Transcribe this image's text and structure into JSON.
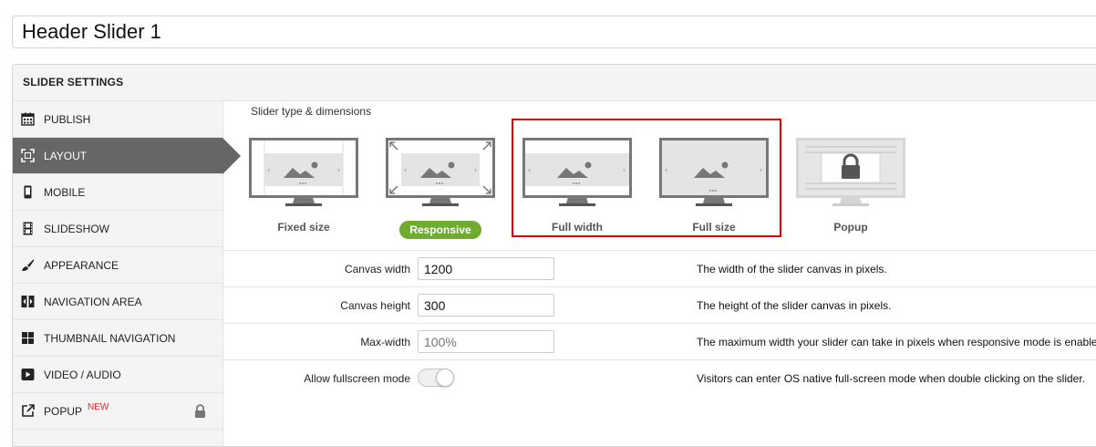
{
  "title": {
    "value": "Header Slider 1"
  },
  "panel": {
    "header": "SLIDER SETTINGS"
  },
  "sidebar": {
    "items": [
      {
        "label": "PUBLISH",
        "icon": "calendar-icon"
      },
      {
        "label": "LAYOUT",
        "icon": "expand-icon",
        "active": true
      },
      {
        "label": "MOBILE",
        "icon": "mobile-icon"
      },
      {
        "label": "SLIDESHOW",
        "icon": "film-icon"
      },
      {
        "label": "APPEARANCE",
        "icon": "brush-icon"
      },
      {
        "label": "NAVIGATION AREA",
        "icon": "navigation-arrows-icon"
      },
      {
        "label": "THUMBNAIL NAVIGATION",
        "icon": "grid-icon"
      },
      {
        "label": "VIDEO / AUDIO",
        "icon": "play-icon"
      },
      {
        "label": "POPUP",
        "icon": "external-link-icon",
        "badge": "NEW",
        "locked": true
      }
    ]
  },
  "slider_type": {
    "section_label": "Slider type & dimensions",
    "types": [
      {
        "label": "Fixed size"
      },
      {
        "label": "Responsive",
        "selected": true
      },
      {
        "label": "Full width"
      },
      {
        "label": "Full size"
      },
      {
        "label": "Popup",
        "locked": true
      }
    ]
  },
  "settings": {
    "rows": [
      {
        "label": "Canvas width",
        "value": "1200",
        "description": "The width of the slider canvas in pixels."
      },
      {
        "label": "Canvas height",
        "value": "300",
        "description": "The height of the slider canvas in pixels."
      },
      {
        "label": "Max-width",
        "placeholder": "100%",
        "description": "The maximum width your slider can take in pixels when responsive mode is enabled."
      },
      {
        "label": "Allow fullscreen mode",
        "description": "Visitors can enter OS native full-screen mode when double clicking on the slider."
      }
    ]
  },
  "colors": {
    "accent_green": "#6fab2e",
    "highlight_red": "#e30000",
    "sidebar_active": "#666666"
  }
}
